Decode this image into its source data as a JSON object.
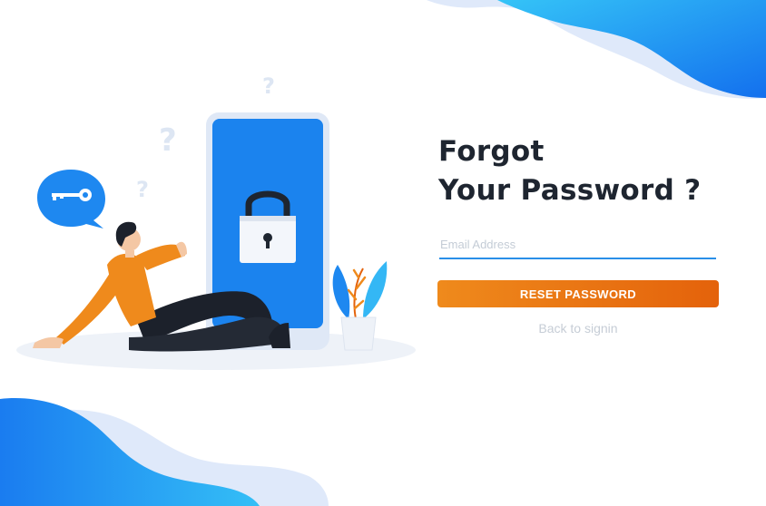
{
  "heading": {
    "line1": "Forgot",
    "line2": "Your Password ?"
  },
  "form": {
    "email_placeholder": "Email Address",
    "email_value": "",
    "reset_label": "RESET PASSWORD",
    "back_label": "Back to signin"
  },
  "illustration": {
    "question_marks": [
      "?",
      "?",
      "?"
    ]
  },
  "colors": {
    "heading": "#1e2530",
    "accent_blue": "#1e88f0",
    "button_start": "#ef8a1c",
    "button_end": "#e4620b",
    "muted_text": "#c6cdd6"
  },
  "icons": [
    "key-icon",
    "padlock-icon",
    "question-mark-icon",
    "plant-icon",
    "person-figure"
  ]
}
